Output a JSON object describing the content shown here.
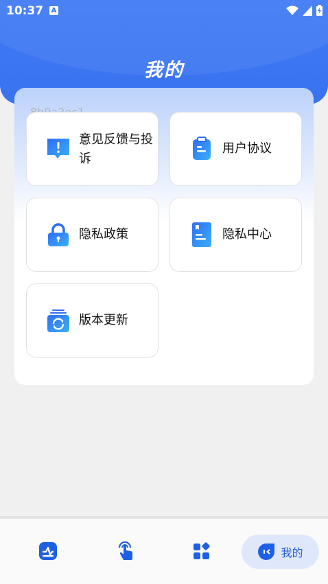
{
  "status_bar": {
    "time": "10:37",
    "app_icon_letter": "A"
  },
  "page": {
    "title": "我的",
    "watermark": "8b9a2ec1"
  },
  "tiles": [
    {
      "label": "意见反馈与投诉",
      "icon": "feedback-icon"
    },
    {
      "label": "用户协议",
      "icon": "clipboard-icon"
    },
    {
      "label": "隐私政策",
      "icon": "lock-icon"
    },
    {
      "label": "隐私中心",
      "icon": "document-icon"
    },
    {
      "label": "版本更新",
      "icon": "refresh-icon"
    }
  ],
  "bottom_nav": {
    "items": [
      {
        "icon": "analytics-icon"
      },
      {
        "icon": "touch-icon"
      },
      {
        "icon": "apps-icon"
      },
      {
        "icon": "profile-icon",
        "label": "我的",
        "active": true
      }
    ]
  },
  "colors": {
    "primary": "#3a72f0",
    "active_nav_bg": "#dfe8fb"
  }
}
